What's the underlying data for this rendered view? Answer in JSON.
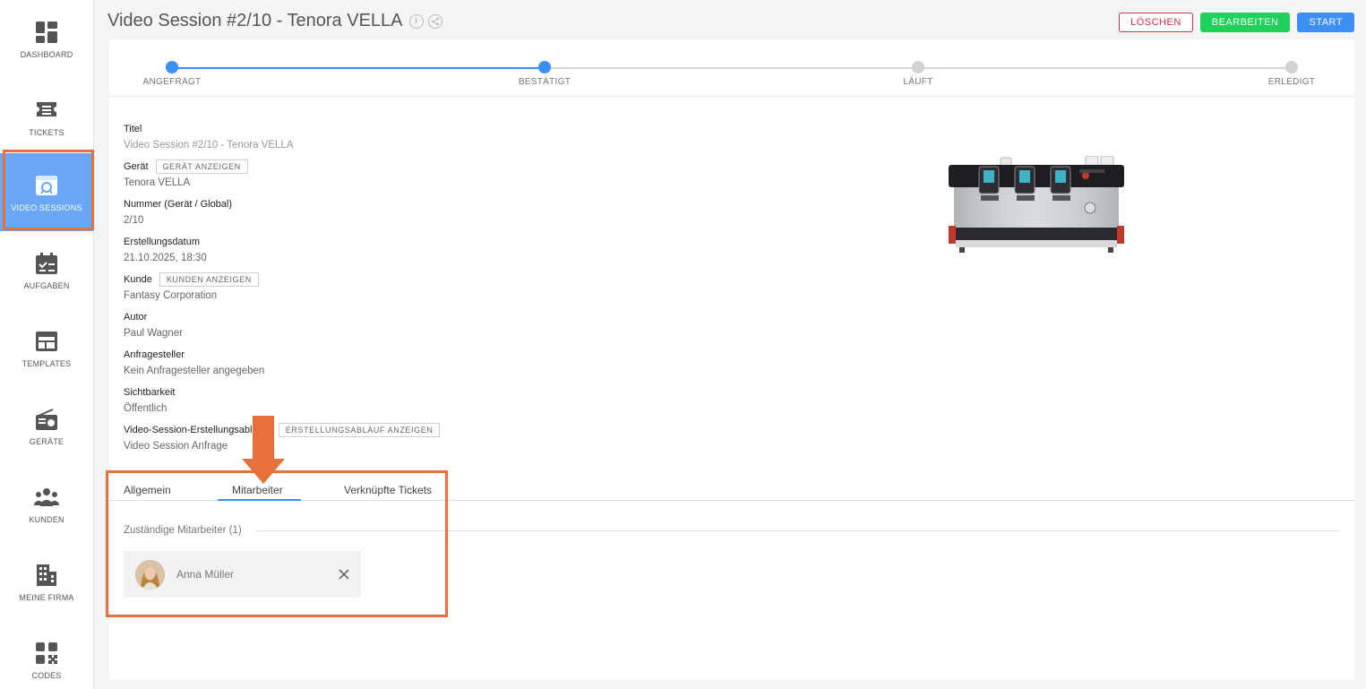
{
  "colors": {
    "accent": "#3d8ef5",
    "sidebar_active": "#6aa8f7",
    "delete": "#d9304b",
    "edit": "#1fd15a",
    "annotation": "#e8703a"
  },
  "sidebar": {
    "items": [
      {
        "label": "DASHBOARD",
        "icon": "dashboard-icon"
      },
      {
        "label": "TICKETS",
        "icon": "tickets-icon"
      },
      {
        "label": "VIDEO SESSIONS",
        "icon": "video-session-icon",
        "active": true
      },
      {
        "label": "AUFGABEN",
        "icon": "tasks-calendar-icon"
      },
      {
        "label": "TEMPLATES",
        "icon": "templates-icon"
      },
      {
        "label": "GERÄTE",
        "icon": "device-radio-icon"
      },
      {
        "label": "KUNDEN",
        "icon": "customers-icon"
      },
      {
        "label": "MEINE FIRMA",
        "icon": "company-building-icon"
      },
      {
        "label": "CODES",
        "icon": "qr-code-icon"
      }
    ]
  },
  "header": {
    "title": "Video Session #2/10 - Tenora VELLA",
    "info_icon": "i",
    "buttons": {
      "delete": "LÖSCHEN",
      "edit": "BEARBEITEN",
      "start": "START"
    }
  },
  "stepper": {
    "steps": [
      {
        "label": "ANGEFRAGT",
        "done": true
      },
      {
        "label": "BESTÄTIGT",
        "done": true
      },
      {
        "label": "LÄUFT",
        "done": false
      },
      {
        "label": "ERLEDIGT",
        "done": false
      }
    ]
  },
  "fields": {
    "title": {
      "label": "Titel",
      "value": "Video Session #2/10 - Tenora VELLA"
    },
    "device": {
      "label": "Gerät",
      "button": "GERÄT ANZEIGEN",
      "value": "Tenora VELLA"
    },
    "number": {
      "label": "Nummer (Gerät / Global)",
      "value": "2/10"
    },
    "created": {
      "label": "Erstellungsdatum",
      "value": "21.10.2025, 18:30"
    },
    "customer": {
      "label": "Kunde",
      "button": "KUNDEN ANZEIGEN",
      "value": "Fantasy Corporation"
    },
    "author": {
      "label": "Autor",
      "value": "Paul Wagner"
    },
    "requester": {
      "label": "Anfragesteller",
      "value": "Kein Anfragesteller angegeben"
    },
    "visibility": {
      "label": "Sichtbarkeit",
      "value": "Öffentlich"
    },
    "flow": {
      "label": "Video-Session-Erstellungsablauf",
      "button": "ERSTELLUNGSABLAUF ANZEIGEN",
      "value": "Video Session Anfrage"
    }
  },
  "tabs": {
    "general": "Allgemein",
    "staff": "Mitarbeiter",
    "tickets": "Verknüpfte Tickets",
    "active": "staff"
  },
  "staff_section": {
    "title": "Zuständige Mitarbeiter (1)",
    "members": [
      {
        "name": "Anna Müller"
      }
    ]
  }
}
